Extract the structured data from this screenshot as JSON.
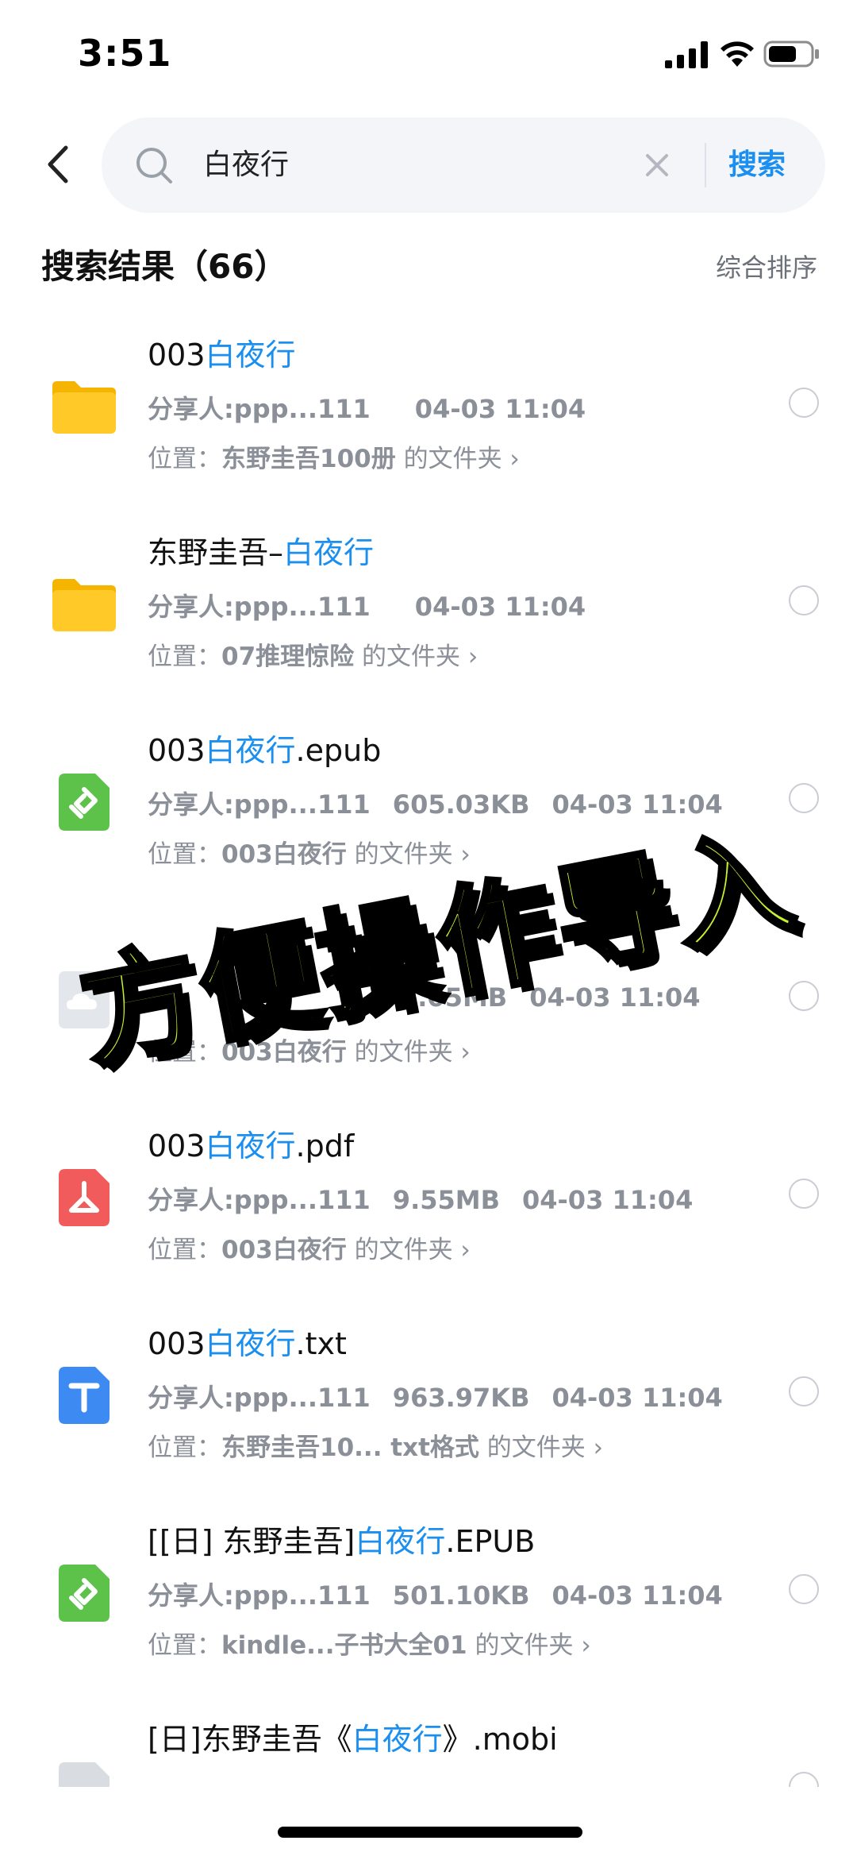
{
  "status_bar": {
    "time": "3:51"
  },
  "search": {
    "query": "白夜行",
    "button_label": "搜索"
  },
  "results_header": {
    "title": "搜索结果（66）",
    "sort_label": "综合排序"
  },
  "items": [
    {
      "icon": "folder-icon",
      "name_prefix": "003",
      "name_highlight": "白夜行",
      "name_suffix": "",
      "sharer": "分享人:ppp...111",
      "size": "",
      "date": "04-03 11:04",
      "location_label": "位置：",
      "location_path": "东野圭吾100册",
      "location_suffix": " 的文件夹 ›"
    },
    {
      "icon": "folder-icon",
      "name_prefix": "东野圭吾–",
      "name_highlight": "白夜行",
      "name_suffix": "",
      "sharer": "分享人:ppp...111",
      "size": "",
      "date": "04-03 11:04",
      "location_label": "位置：",
      "location_path": "07推理惊险",
      "location_suffix": " 的文件夹 ›"
    },
    {
      "icon": "epub-icon",
      "name_prefix": "003",
      "name_highlight": "白夜行",
      "name_suffix": ".epub",
      "sharer": "分享人:ppp...111",
      "size": "605.03KB",
      "date": "04-03 11:04",
      "location_label": "位置：",
      "location_path": "003白夜行",
      "location_suffix": " 的文件夹 ›"
    },
    {
      "icon": "cloud-file-icon",
      "name_prefix": "",
      "name_highlight": "",
      "name_suffix": "",
      "sharer": "",
      "size": "1.05MB",
      "date": "04-03 11:04",
      "location_label": "位置：",
      "location_path": "003白夜行",
      "location_suffix": " 的文件夹 ›"
    },
    {
      "icon": "pdf-icon",
      "name_prefix": "003",
      "name_highlight": "白夜行",
      "name_suffix": ".pdf",
      "sharer": "分享人:ppp...111",
      "size": "9.55MB",
      "date": "04-03 11:04",
      "location_label": "位置：",
      "location_path": "003白夜行",
      "location_suffix": " 的文件夹 ›"
    },
    {
      "icon": "txt-icon",
      "name_prefix": "003",
      "name_highlight": "白夜行",
      "name_suffix": ".txt",
      "sharer": "分享人:ppp...111",
      "size": "963.97KB",
      "date": "04-03 11:04",
      "location_label": "位置：",
      "location_path": "东野圭吾10... txt格式",
      "location_suffix": " 的文件夹 ›"
    },
    {
      "icon": "epub-icon",
      "name_prefix": "[[日] 东野圭吾]",
      "name_highlight": "白夜行",
      "name_suffix": ".EPUB",
      "sharer": "分享人:ppp...111",
      "size": "501.10KB",
      "date": "04-03 11:04",
      "location_label": "位置：",
      "location_path": "kindle...子书大全01",
      "location_suffix": " 的文件夹 ›"
    },
    {
      "icon": "mobi-icon",
      "name_prefix": "[日]东野圭吾《",
      "name_highlight": "白夜行",
      "name_suffix": "》.mobi",
      "sharer": "",
      "size": "",
      "date": "",
      "location_label": "",
      "location_path": "",
      "location_suffix": ""
    }
  ],
  "overlay": {
    "text": "方便操作导入"
  },
  "colors": {
    "accent": "#1a8ff0",
    "folder": "#ffc928",
    "epub": "#5cc24a",
    "pdf": "#f25b5b",
    "txt": "#3d8bf2",
    "overlay_fill": "#c6f32e"
  }
}
